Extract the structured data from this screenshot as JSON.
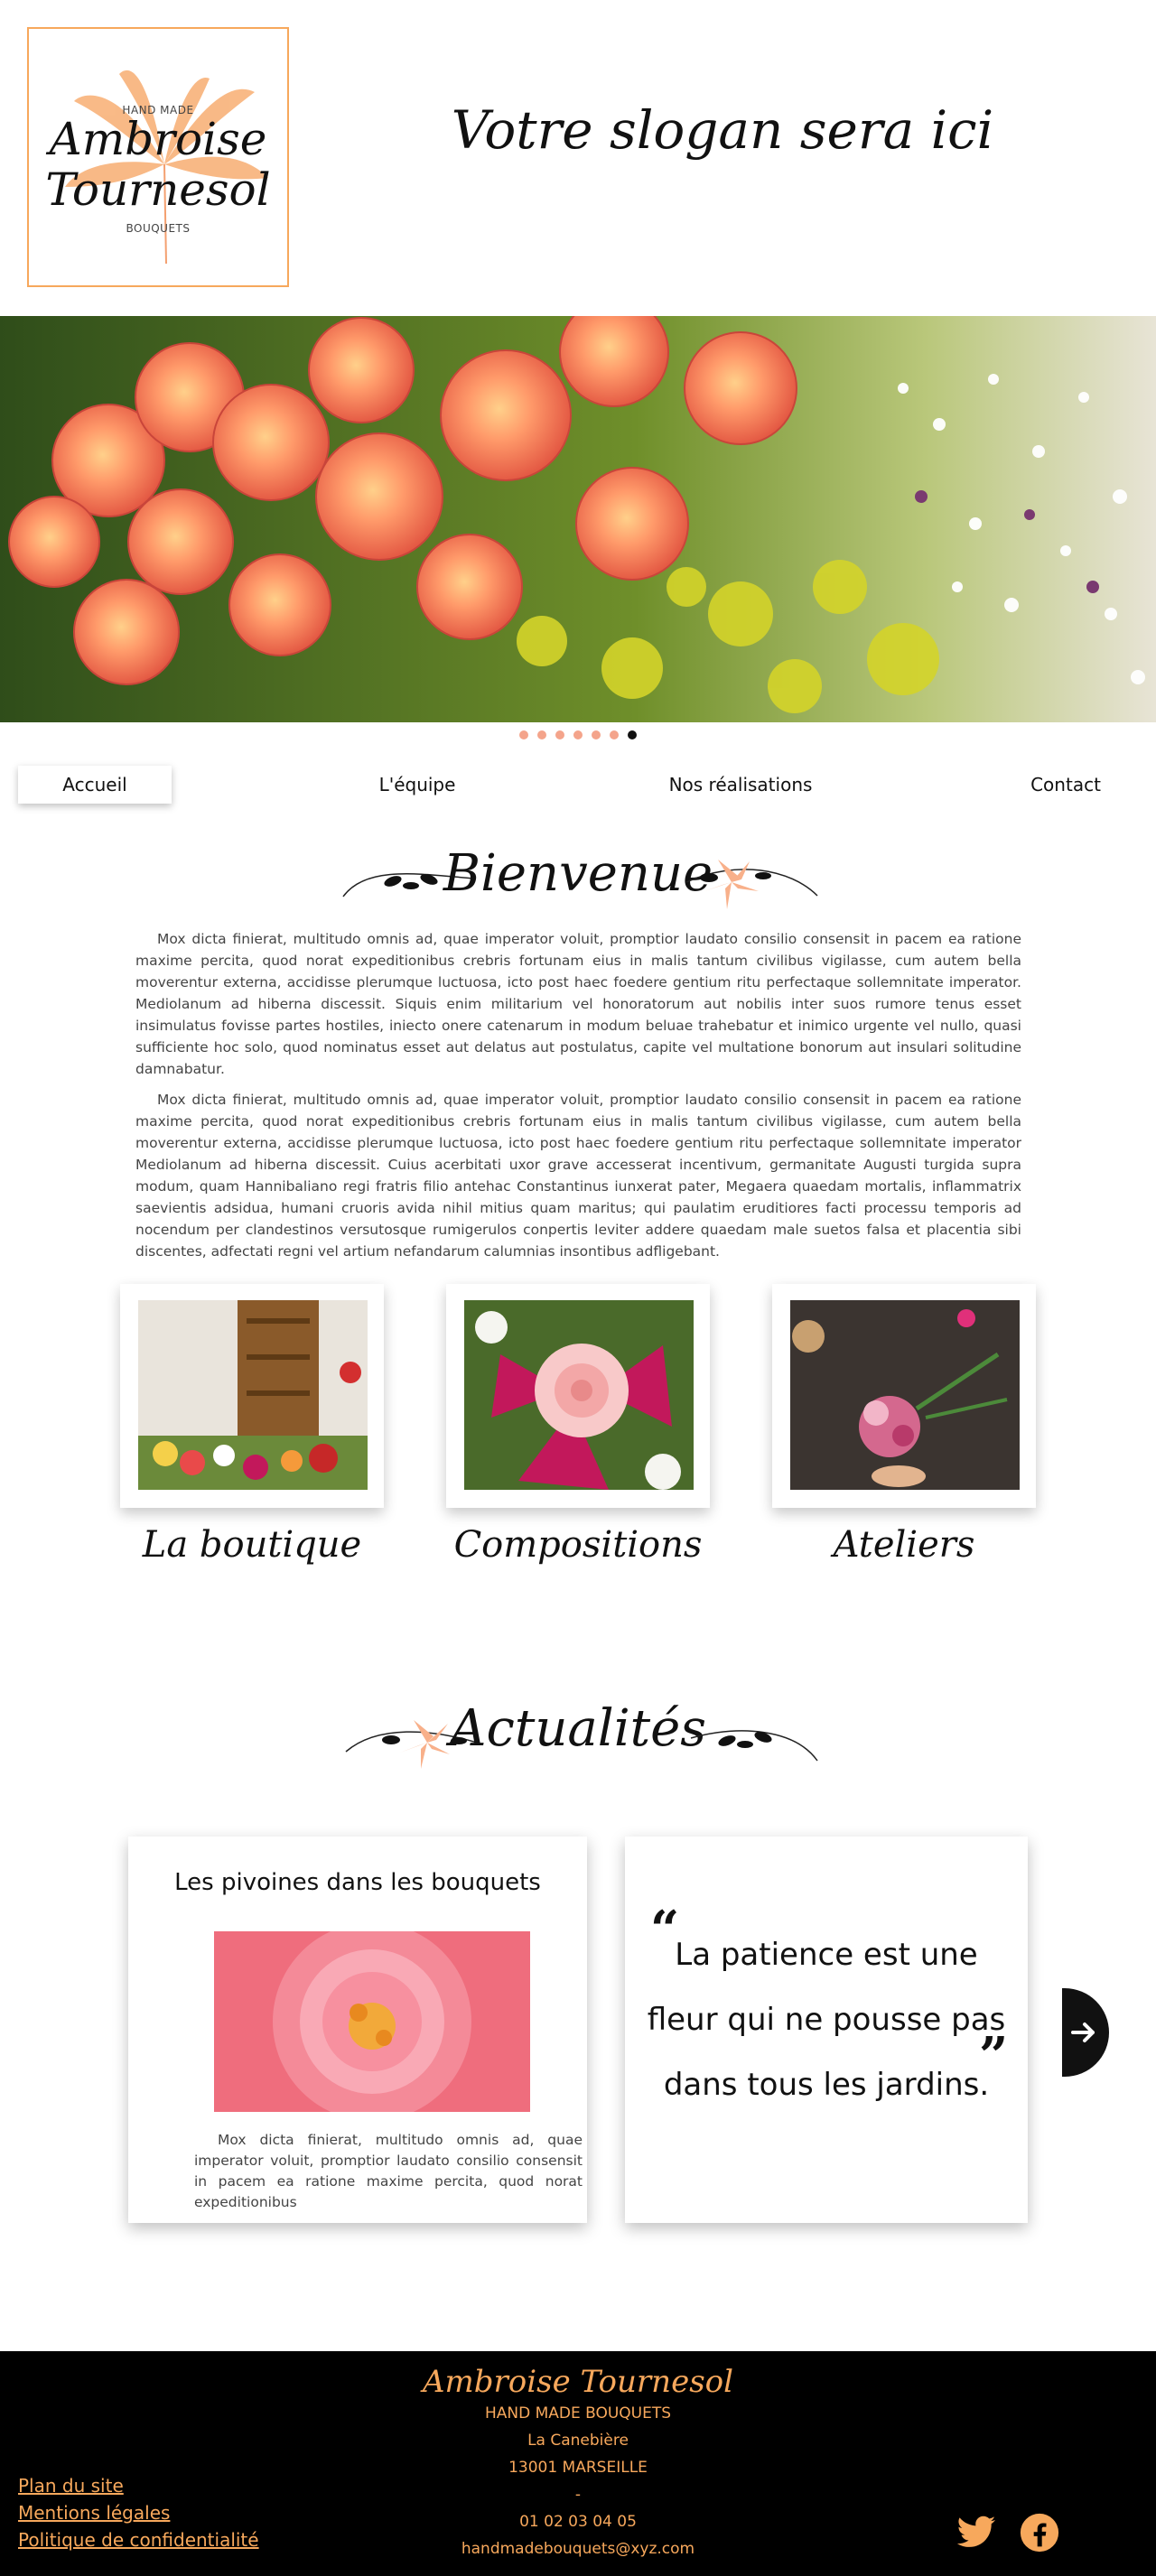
{
  "header": {
    "logo": {
      "top": "HAND MADE",
      "name_line1": "Ambroise",
      "name_line2": "Tournesol",
      "bottom": "BOUQUETS"
    },
    "slogan": "Votre slogan sera ici"
  },
  "carousel": {
    "slide_count": 7,
    "active_slide": 6
  },
  "nav": {
    "items": [
      {
        "label": "Accueil",
        "active": true
      },
      {
        "label": "L'équipe",
        "active": false
      },
      {
        "label": "Nos réalisations",
        "active": false
      },
      {
        "label": "Contact",
        "active": false
      }
    ]
  },
  "welcome": {
    "title": "Bienvenue",
    "paragraphs": [
      "Mox dicta finierat, multitudo omnis ad, quae imperator voluit, promptior laudato consilio consensit in pacem ea ratione maxime percita, quod norat expeditionibus crebris fortunam eius in malis tantum civilibus vigilasse, cum autem bella moverentur externa, accidisse plerumque luctuosa, icto post haec foedere gentium ritu perfectaque sollemnitate imperator. Mediolanum ad hiberna discessit. Siquis enim militarium vel honoratorum aut nobilis inter suos rumore tenus esset insimulatus fovisse partes hostiles, iniecto onere catenarum in modum beluae trahebatur et inimico urgente vel nullo, quasi sufficiente hoc solo, quod nominatus esset aut delatus aut postulatus, capite vel multatione bonorum aut insulari solitudine damnabatur.",
      "Mox dicta finierat, multitudo omnis ad, quae imperator voluit, promptior laudato consilio consensit in pacem ea ratione maxime percita, quod norat expeditionibus crebris fortunam eius in malis tantum civilibus vigilasse, cum autem bella moverentur externa, accidisse plerumque luctuosa, icto post haec foedere gentium ritu perfectaque sollemnitate imperator Mediolanum ad hiberna discessit. Cuius acerbitati uxor grave accesserat incentivum, germanitate Augusti turgida supra modum, quam Hannibaliano regi fratris filio antehac Constantinus iunxerat pater, Megaera quaedam mortalis, inflammatrix saevientis adsidua, humani cruoris avida nihil mitius quam maritus; qui paulatim eruditiores facti processu temporis ad nocendum per clandestinos versutosque rumigerulos conpertis leviter addere quaedam male suetos falsa et placentia sibi discentes, adfectati regni vel artium nefandarum calumnias insontibus adfligebant."
    ]
  },
  "cards": [
    {
      "caption": "La boutique"
    },
    {
      "caption": "Compositions"
    },
    {
      "caption": "Ateliers"
    }
  ],
  "news": {
    "title": "Actualités",
    "article": {
      "title": "Les pivoines dans les bouquets",
      "excerpt": "Mox dicta finierat, multitudo omnis ad, quae imperator voluit, promptior laudato consilio consensit in pacem ea ratione maxime percita, quod norat expeditionibus"
    },
    "quote": {
      "line1": "La patience est une",
      "line2": "fleur qui ne pousse pas",
      "line3": "dans tous les jardins.",
      "open_mark": "“",
      "close_mark": "”"
    },
    "next_icon": "arrow-right-icon"
  },
  "footer": {
    "brand": "Ambroise Tournesol",
    "tagline": "HAND MADE BOUQUETS",
    "street": "La Canebière",
    "city": "13001 MARSEILLE",
    "separator": "-",
    "phone": "01 02 03 04 05",
    "email": "handmadebouquets@xyz.com",
    "links": [
      "Plan du site",
      "Mentions légales",
      "Politique de confidentialité"
    ],
    "social": [
      "twitter-icon",
      "facebook-icon"
    ]
  },
  "colors": {
    "accent": "#f7a85c",
    "dark": "#000000",
    "dot": "#f4a48b"
  }
}
